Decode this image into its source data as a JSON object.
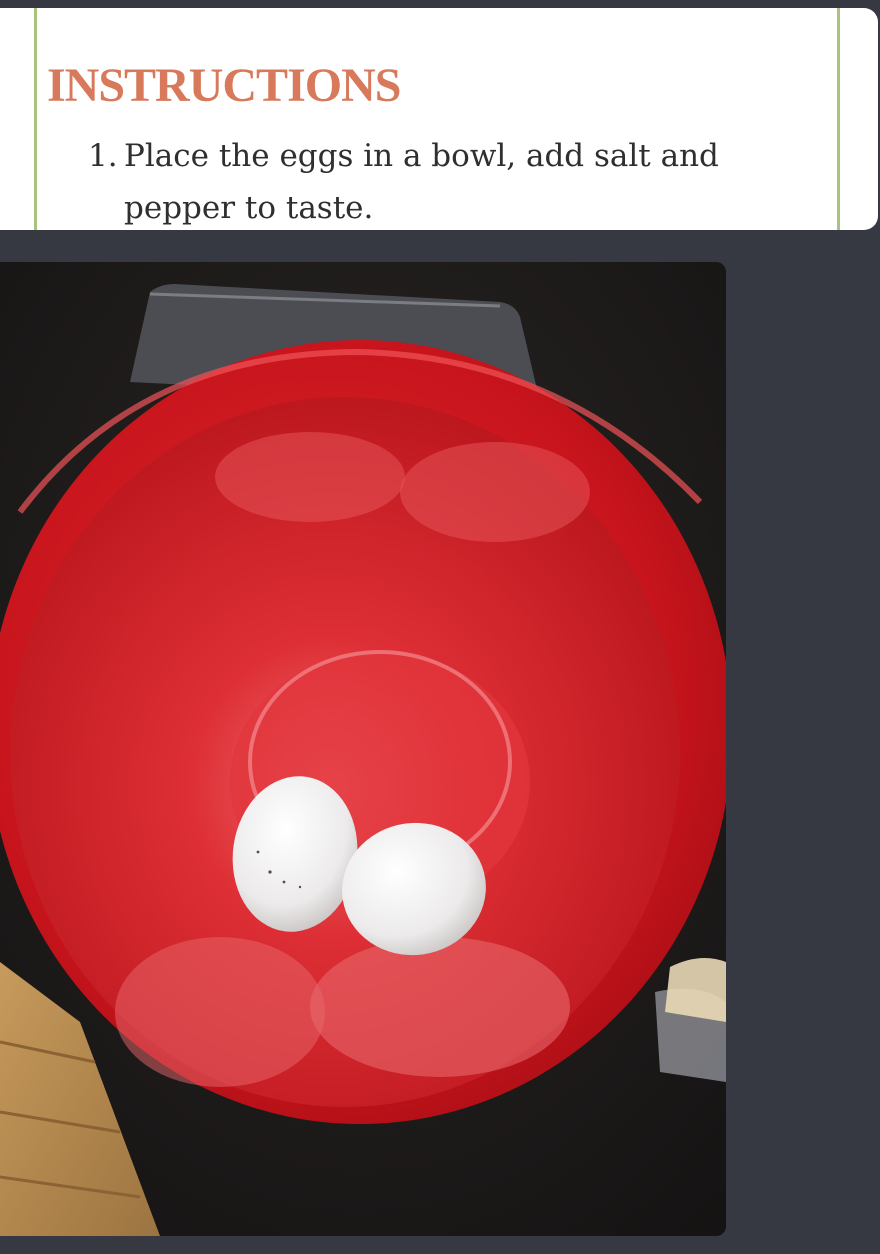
{
  "recipe": {
    "heading": "INSTRUCTIONS",
    "steps": [
      {
        "number": "1.",
        "text": "Place the eggs in a bowl, add salt and pepper to taste."
      }
    ]
  },
  "colors": {
    "background": "#363942",
    "heading": "#d7795a",
    "accent_rule": "#a9c27d",
    "bowl": "#c8141c"
  }
}
